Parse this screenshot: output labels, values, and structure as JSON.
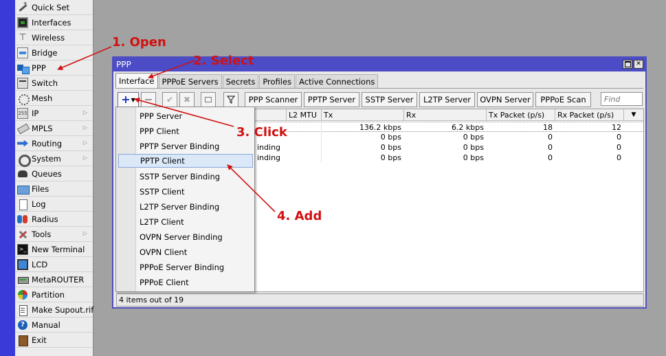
{
  "sidebar": {
    "items": [
      {
        "label": "Quick Set",
        "icon": "quick-set-icon"
      },
      {
        "label": "Interfaces",
        "icon": "interfaces-icon"
      },
      {
        "label": "Wireless",
        "icon": "wireless-icon"
      },
      {
        "label": "Bridge",
        "icon": "bridge-icon"
      },
      {
        "label": "PPP",
        "icon": "ppp-icon"
      },
      {
        "label": "Switch",
        "icon": "switch-icon"
      },
      {
        "label": "Mesh",
        "icon": "mesh-icon"
      },
      {
        "label": "IP",
        "icon": "ip-icon"
      },
      {
        "label": "MPLS",
        "icon": "mpls-icon"
      },
      {
        "label": "Routing",
        "icon": "routing-icon"
      },
      {
        "label": "System",
        "icon": "system-icon"
      },
      {
        "label": "Queues",
        "icon": "queues-icon"
      },
      {
        "label": "Files",
        "icon": "files-icon"
      },
      {
        "label": "Log",
        "icon": "log-icon"
      },
      {
        "label": "Radius",
        "icon": "radius-icon"
      },
      {
        "label": "Tools",
        "icon": "tools-icon"
      },
      {
        "label": "New Terminal",
        "icon": "terminal-icon"
      },
      {
        "label": "LCD",
        "icon": "lcd-icon"
      },
      {
        "label": "MetaROUTER",
        "icon": "metarouter-icon"
      },
      {
        "label": "Partition",
        "icon": "partition-icon"
      },
      {
        "label": "Make Supout.rif",
        "icon": "supout-icon"
      },
      {
        "label": "Manual",
        "icon": "manual-icon"
      },
      {
        "label": "Exit",
        "icon": "exit-icon"
      }
    ],
    "submenu_arrow": "▷"
  },
  "window": {
    "title": "PPP",
    "tabs": [
      "Interface",
      "PPPoE Servers",
      "Secrets",
      "Profiles",
      "Active Connections"
    ],
    "toolbar": {
      "add_glyph": "+",
      "dropdown_glyph": "▼",
      "buttons": [
        "PPP Scanner",
        "PPTP Server",
        "SSTP Server",
        "L2TP Server",
        "OVPN Server",
        "PPPoE Scan"
      ],
      "find_placeholder": "Find"
    },
    "table": {
      "headers": [
        "L2 MTU",
        "Tx",
        "Rx",
        "Tx Packet (p/s)",
        "Rx Packet (p/s)"
      ],
      "rows": [
        {
          "name": "",
          "l2mtu": "",
          "tx": "136.2 kbps",
          "rx": "6.2 kbps",
          "txp": "18",
          "rxp": "12"
        },
        {
          "name": "",
          "l2mtu": "",
          "tx": "0 bps",
          "rx": "0 bps",
          "txp": "0",
          "rxp": "0"
        },
        {
          "name": "inding",
          "l2mtu": "",
          "tx": "0 bps",
          "rx": "0 bps",
          "txp": "0",
          "rxp": "0"
        },
        {
          "name": "inding",
          "l2mtu": "",
          "tx": "0 bps",
          "rx": "0 bps",
          "txp": "0",
          "rxp": "0"
        }
      ]
    },
    "status": "4 items out of 19"
  },
  "dropdown": {
    "items": [
      "PPP Server",
      "PPP Client",
      "PPTP Server Binding",
      "PPTP Client",
      "SSTP Server Binding",
      "SSTP Client",
      "L2TP Server Binding",
      "L2TP Client",
      "OVPN Server Binding",
      "OVPN Client",
      "PPPoE Server Binding",
      "PPPoE Client"
    ],
    "highlighted": "PPTP Client"
  },
  "annotations": {
    "step1": "1. Open",
    "step2": "2. Select",
    "step3": "3. Click",
    "step4": "4. Add",
    "color": "#d11010"
  },
  "colors": {
    "title_bar": "#4c4cc7",
    "left_strip": "#3a3ad8",
    "add_plus": "#1a2ec6"
  }
}
